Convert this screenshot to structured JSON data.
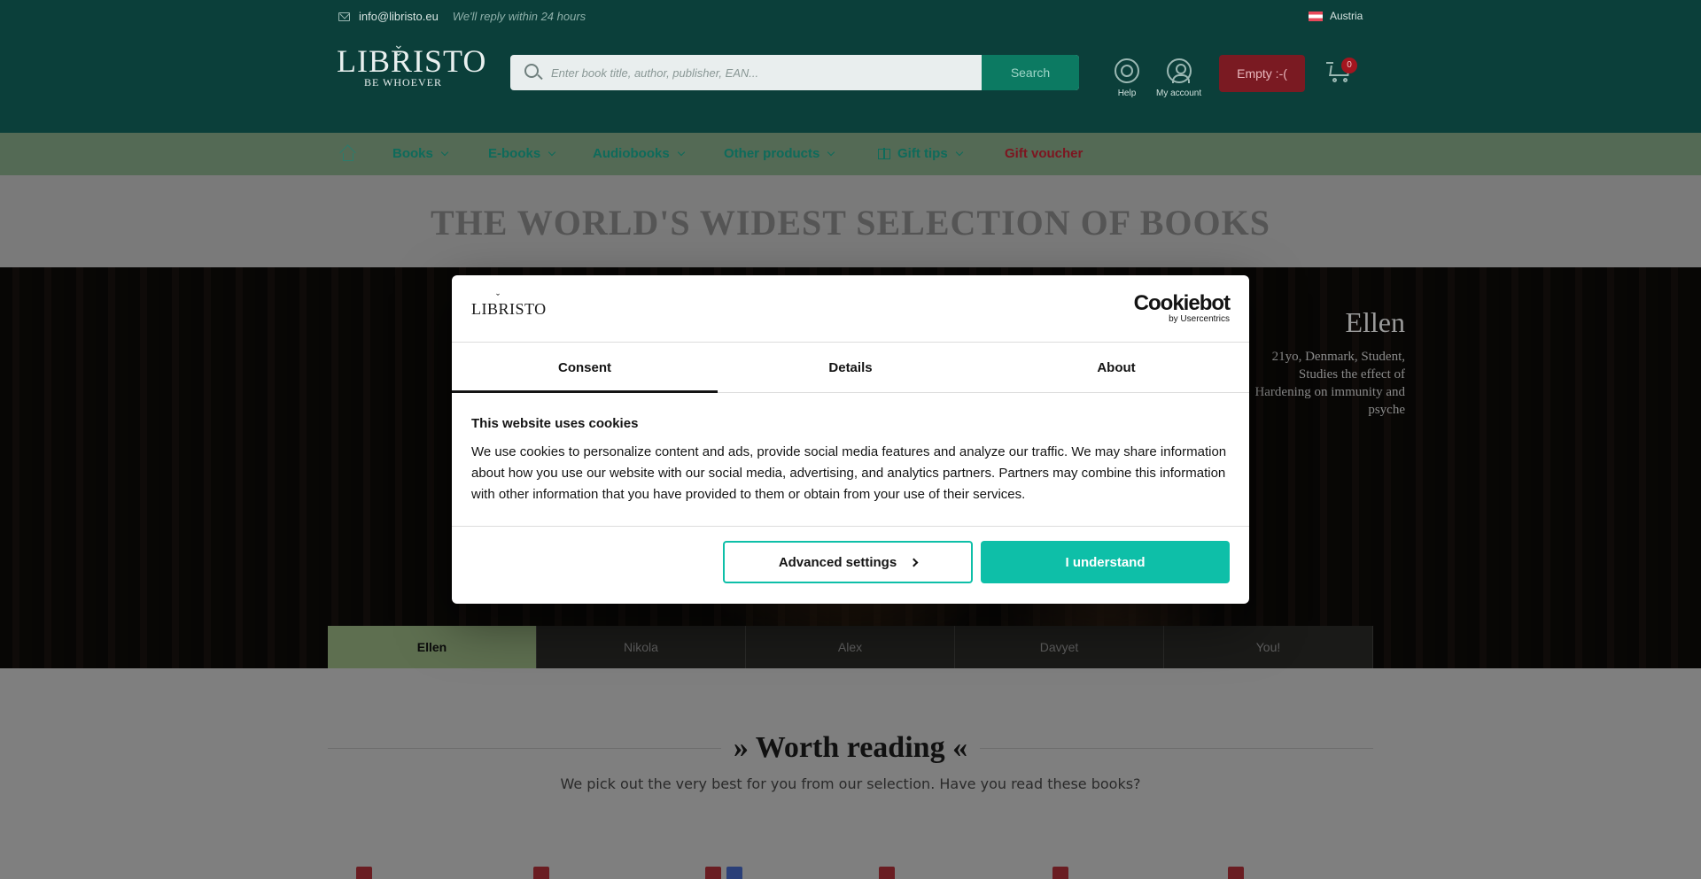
{
  "header": {
    "email": "info@libristo.eu",
    "reply_note": "We'll reply within 24 hours",
    "country": "Austria",
    "logo_name": "LIBRISTO",
    "logo_tagline": "BE WHOEVER",
    "search_placeholder": "Enter book title, author, publisher, EAN...",
    "search_button": "Search",
    "help_label": "Help",
    "account_label": "My account",
    "cart_label": "Empty :-(",
    "cart_count": "0"
  },
  "nav": {
    "items": [
      {
        "label": "Books"
      },
      {
        "label": "E-books"
      },
      {
        "label": "Audiobooks"
      },
      {
        "label": "Other products"
      },
      {
        "label": "Gift tips"
      },
      {
        "label": "Gift voucher"
      }
    ]
  },
  "hero": {
    "title": "THE WORLD'S WIDEST SELECTION OF BOOKS",
    "persona_name": "Ellen",
    "persona_description": "21yo, Denmark, Student, Studies the effect of Hardening on immunity and psyche",
    "tabs": [
      {
        "label": "Ellen",
        "active": true
      },
      {
        "label": "Nikola",
        "active": false
      },
      {
        "label": "Alex",
        "active": false
      },
      {
        "label": "Davyet",
        "active": false
      },
      {
        "label": "You!",
        "active": false
      }
    ]
  },
  "section": {
    "title": "» Worth reading «",
    "subtitle": "We pick out the very best for you from our selection. Have you read these books?"
  },
  "cookie_dialog": {
    "logo": "LIBRISTO",
    "provider": "Cookiebot",
    "provider_by": "by Usercentrics",
    "tabs": [
      {
        "label": "Consent",
        "active": true
      },
      {
        "label": "Details",
        "active": false
      },
      {
        "label": "About",
        "active": false
      }
    ],
    "heading": "This website uses cookies",
    "body": "We use cookies to personalize content and ads, provide social media features and analyze our traffic. We may share information about how you use our website with our social media, advertising, and analytics partners. Partners may combine this information with other information that you have provided to them or obtain from your use of their services.",
    "advanced_button": "Advanced settings",
    "accept_button": "I understand"
  },
  "colors": {
    "header_bg": "#0b3f3a",
    "accent_teal": "#0ebfa8",
    "cart_red": "#7a1a22"
  }
}
